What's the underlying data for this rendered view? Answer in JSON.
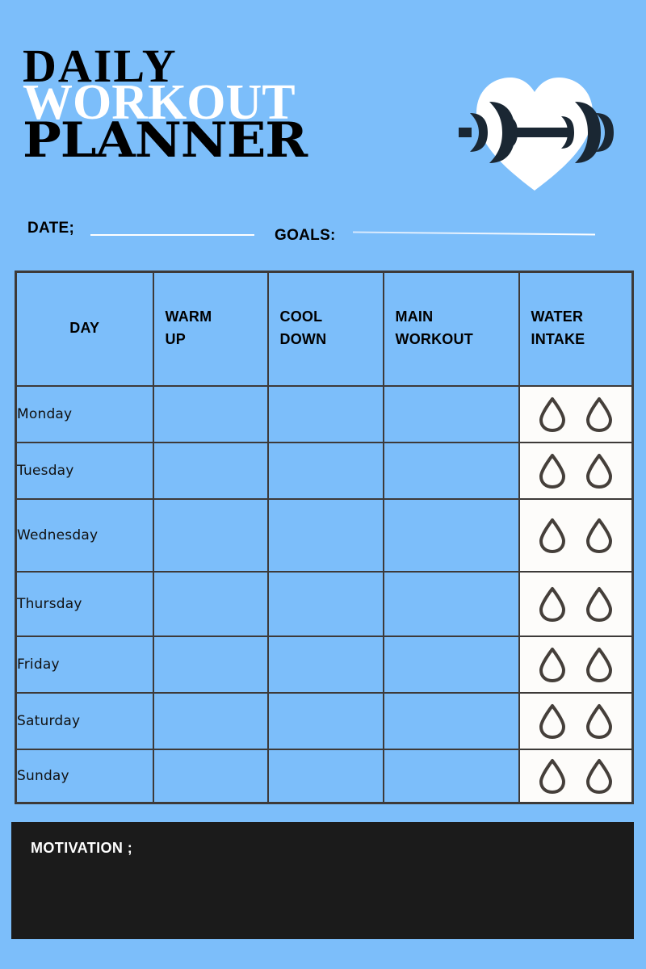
{
  "page": {
    "background_color": "#7cbefa",
    "accent_dark": "#1b1b1b",
    "border_color": "#3d3a38",
    "water_cell_color": "#fdfcfa",
    "dumbbell_color": "#1a2733",
    "heart_color": "#ffffff"
  },
  "header": {
    "title_line1": "DAILY",
    "title_line2": "WORKOUT",
    "title_line3": "PLANNER",
    "logo_icon": "heart-dumbbell-icon"
  },
  "meta": {
    "date_label": "DATE;",
    "date_value": "",
    "goals_label": "GOALS:",
    "goals_value": ""
  },
  "table": {
    "headers": [
      {
        "id": "day",
        "lines": [
          "DAY"
        ],
        "align": "center"
      },
      {
        "id": "warm",
        "lines": [
          "WARM",
          "UP"
        ],
        "align": "left"
      },
      {
        "id": "cool",
        "lines": [
          "COOL",
          "DOWN"
        ],
        "align": "left"
      },
      {
        "id": "main",
        "lines": [
          "MAIN",
          "WORKOUT"
        ],
        "align": "left"
      },
      {
        "id": "water",
        "lines": [
          "WATER",
          "INTAKE"
        ],
        "align": "left"
      }
    ],
    "rows": [
      {
        "day": "Monday",
        "warm_up": "",
        "cool_down": "",
        "main_workout": "",
        "water_droplets": 2
      },
      {
        "day": "Tuesday",
        "warm_up": "",
        "cool_down": "",
        "main_workout": "",
        "water_droplets": 2
      },
      {
        "day": "Wednesday",
        "warm_up": "",
        "cool_down": "",
        "main_workout": "",
        "water_droplets": 2
      },
      {
        "day": "Thursday",
        "warm_up": "",
        "cool_down": "",
        "main_workout": "",
        "water_droplets": 2
      },
      {
        "day": "Friday",
        "warm_up": "",
        "cool_down": "",
        "main_workout": "",
        "water_droplets": 2
      },
      {
        "day": "Saturday",
        "warm_up": "",
        "cool_down": "",
        "main_workout": "",
        "water_droplets": 2
      },
      {
        "day": "Sunday",
        "warm_up": "",
        "cool_down": "",
        "main_workout": "",
        "water_droplets": 2
      }
    ]
  },
  "motivation": {
    "label": "MOTIVATION ;",
    "value": ""
  }
}
